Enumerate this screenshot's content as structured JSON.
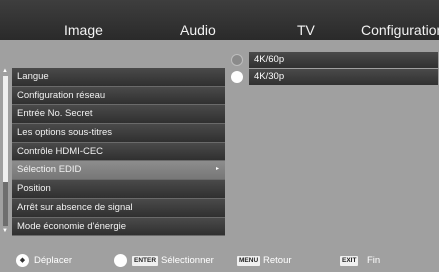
{
  "tabs": [
    "Image",
    "Audio",
    "TV",
    "Configuration"
  ],
  "menu": {
    "items": [
      {
        "label": "Langue",
        "selected": false
      },
      {
        "label": "Configuration réseau",
        "selected": false
      },
      {
        "label": "Entrée No. Secret",
        "selected": false
      },
      {
        "label": "Les options sous-titres",
        "selected": false
      },
      {
        "label": "Contrôle HDMI-CEC",
        "selected": false
      },
      {
        "label": "Sélection EDID",
        "selected": true
      },
      {
        "label": "Position",
        "selected": false
      },
      {
        "label": "Arrêt sur absence de signal",
        "selected": false
      },
      {
        "label": "Mode économie d'énergie",
        "selected": false
      }
    ],
    "submenu_arrow": "▸"
  },
  "options": [
    {
      "label": "4K/60p",
      "selected": false
    },
    {
      "label": "4K/30p",
      "selected": true
    }
  ],
  "help": {
    "move": "Déplacer",
    "enter_key": "ENTER",
    "select": "Sélectionner",
    "menu_key": "MENU",
    "back": "Retour",
    "exit_key": "EXIT",
    "end": "Fin"
  },
  "colors": {
    "background": "#a0a0a0",
    "tab_bar": "#2a2a2a",
    "item": "#3c3c3c",
    "item_selected": "#808080"
  }
}
